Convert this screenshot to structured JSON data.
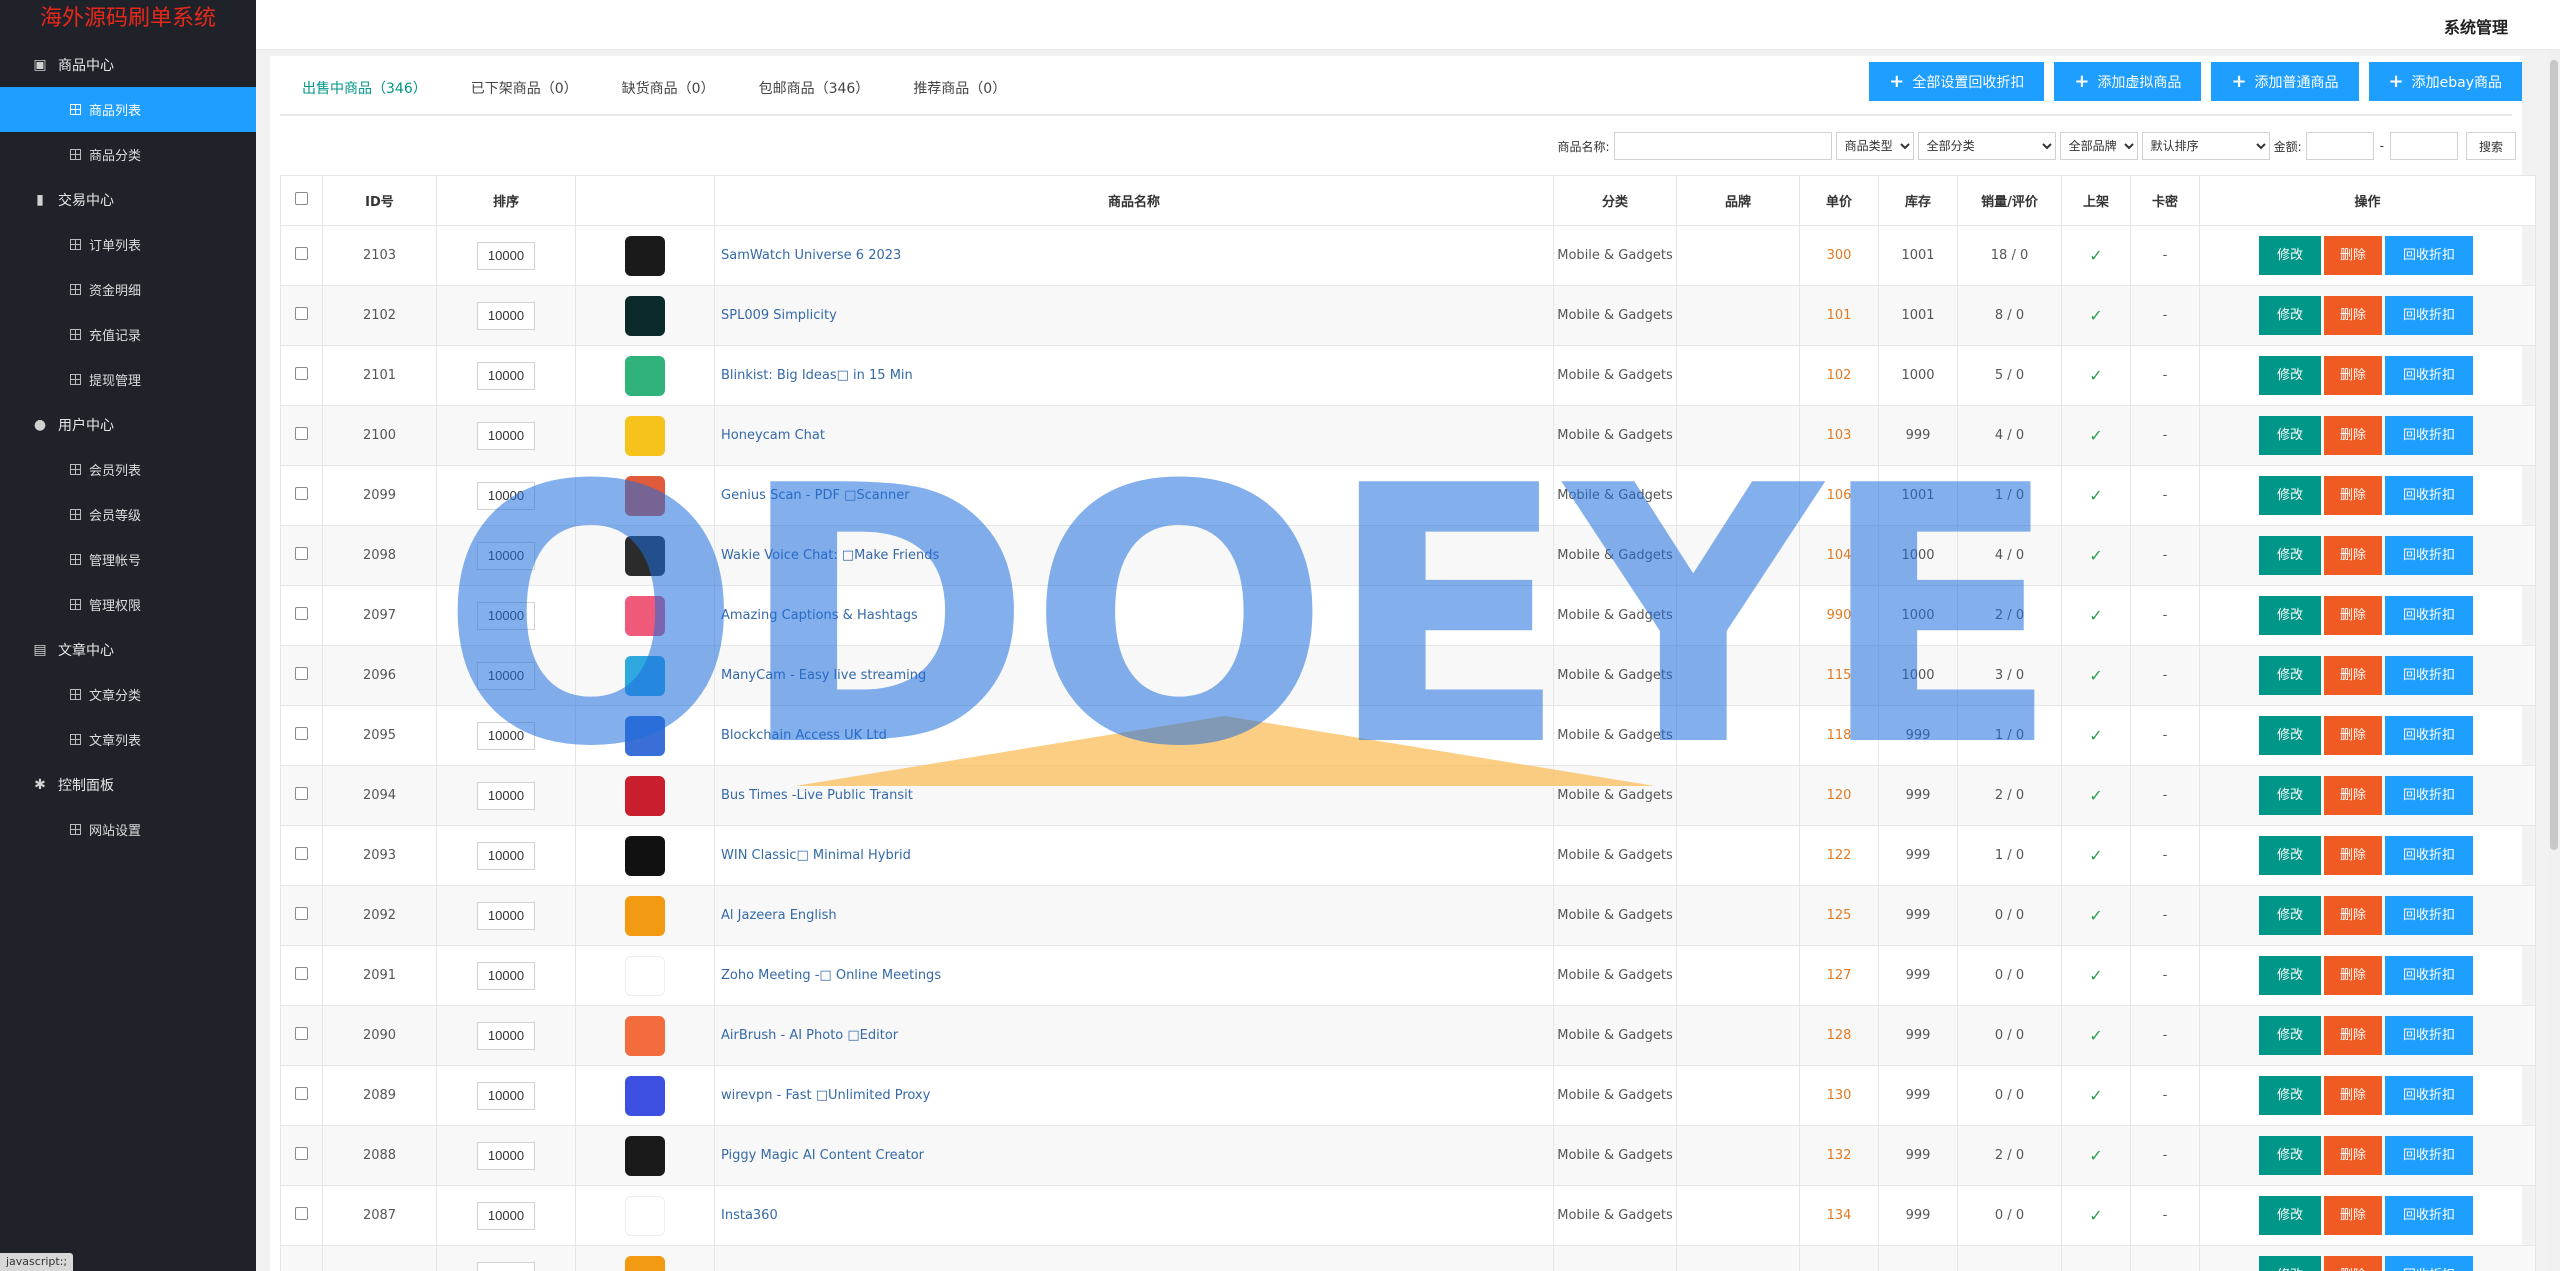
{
  "app_title": "海外源码刷单系统",
  "header": {
    "system_name": "系统管理"
  },
  "sidebar": {
    "sections": [
      {
        "label": "商品中心",
        "icon": "chart-box-icon",
        "items": [
          {
            "label": "商品列表",
            "active": true
          },
          {
            "label": "商品分类",
            "active": false
          }
        ]
      },
      {
        "label": "交易中心",
        "icon": "bar-chart-icon",
        "items": [
          {
            "label": "订单列表"
          },
          {
            "label": "资金明细"
          },
          {
            "label": "充值记录"
          },
          {
            "label": "提现管理"
          }
        ]
      },
      {
        "label": "用户中心",
        "icon": "user-icon",
        "items": [
          {
            "label": "会员列表"
          },
          {
            "label": "会员等级"
          },
          {
            "label": "管理帐号"
          },
          {
            "label": "管理权限"
          }
        ]
      },
      {
        "label": "文章中心",
        "icon": "document-icon",
        "items": [
          {
            "label": "文章分类"
          },
          {
            "label": "文章列表"
          }
        ]
      },
      {
        "label": "控制面板",
        "icon": "gear-icon",
        "items": [
          {
            "label": "网站设置"
          }
        ]
      }
    ]
  },
  "tabs": [
    {
      "label": "出售中商品（346）",
      "active": true
    },
    {
      "label": "已下架商品（0）"
    },
    {
      "label": "缺货商品（0）"
    },
    {
      "label": "包邮商品（346）"
    },
    {
      "label": "推荐商品（0）"
    }
  ],
  "actions": [
    "全部设置回收折扣",
    "添加虚拟商品",
    "添加普通商品",
    "添加ebay商品"
  ],
  "filters": {
    "name_label": "商品名称:",
    "name_value": "",
    "type_select": "商品类型",
    "category_select": "全部分类",
    "brand_select": "全部品牌",
    "sort_select": "默认排序",
    "amount_label": "金额:",
    "amount_sep": "-",
    "search_label": "搜索"
  },
  "table": {
    "headers": [
      "ID号",
      "排序",
      "商品名称",
      "分类",
      "品牌",
      "单价",
      "库存",
      "销量/评价",
      "上架",
      "卡密",
      "操作"
    ],
    "rows": [
      {
        "id": "2103",
        "sort": "10000",
        "name": "SamWatch Universe 6 2023",
        "category": "Mobile & Gadgets",
        "brand": "",
        "price": "300",
        "stock": "1001",
        "sales": "18 / 0",
        "card": "-",
        "thumb": "#1a1a1a"
      },
      {
        "id": "2102",
        "sort": "10000",
        "name": "SPL009 Simplicity",
        "category": "Mobile & Gadgets",
        "brand": "",
        "price": "101",
        "stock": "1001",
        "sales": "8 / 0",
        "card": "-",
        "thumb": "#0d2a2a"
      },
      {
        "id": "2101",
        "sort": "10000",
        "name": "Blinkist: Big Ideas\u0000 in 15 Min",
        "category": "Mobile & Gadgets",
        "brand": "",
        "price": "102",
        "stock": "1000",
        "sales": "5 / 0",
        "card": "-",
        "thumb": "#2fb37a"
      },
      {
        "id": "2100",
        "sort": "10000",
        "name": "Honeycam Chat",
        "category": "Mobile & Gadgets",
        "brand": "",
        "price": "103",
        "stock": "999",
        "sales": "4 / 0",
        "card": "-",
        "thumb": "#f6c21c"
      },
      {
        "id": "2099",
        "sort": "10000",
        "name": "Genius Scan - PDF \u0000Scanner",
        "category": "Mobile & Gadgets",
        "brand": "",
        "price": "106",
        "stock": "1001",
        "sales": "1 / 0",
        "card": "-",
        "thumb": "#e05a3c"
      },
      {
        "id": "2098",
        "sort": "10000",
        "name": "Wakie Voice Chat: \u0000Make Friends",
        "category": "Mobile & Gadgets",
        "brand": "",
        "price": "104",
        "stock": "1000",
        "sales": "4 / 0",
        "card": "-",
        "thumb": "#2b2b2b"
      },
      {
        "id": "2097",
        "sort": "10000",
        "name": "Amazing Captions & Hashtags",
        "category": "Mobile & Gadgets",
        "brand": "",
        "price": "990",
        "stock": "1000",
        "sales": "2 / 0",
        "card": "-",
        "thumb": "#f05a7a"
      },
      {
        "id": "2096",
        "sort": "10000",
        "name": "ManyCam - Easy live streaming",
        "category": "Mobile & Gadgets",
        "brand": "",
        "price": "115",
        "stock": "1000",
        "sales": "3 / 0",
        "card": "-",
        "thumb": "#2fa8e0"
      },
      {
        "id": "2095",
        "sort": "10000",
        "name": "Blockchain Access UK Ltd",
        "category": "Mobile & Gadgets",
        "brand": "",
        "price": "118",
        "stock": "999",
        "sales": "1 / 0",
        "card": "-",
        "thumb": "#3b6fd8"
      },
      {
        "id": "2094",
        "sort": "10000",
        "name": "Bus Times -Live Public Transit",
        "category": "Mobile & Gadgets",
        "brand": "",
        "price": "120",
        "stock": "999",
        "sales": "2 / 0",
        "card": "-",
        "thumb": "#c81e2e"
      },
      {
        "id": "2093",
        "sort": "10000",
        "name": "WIN Classic\u0000 Minimal Hybrid",
        "category": "Mobile & Gadgets",
        "brand": "",
        "price": "122",
        "stock": "999",
        "sales": "1 / 0",
        "card": "-",
        "thumb": "#111111"
      },
      {
        "id": "2092",
        "sort": "10000",
        "name": "Al Jazeera English",
        "category": "Mobile & Gadgets",
        "brand": "",
        "price": "125",
        "stock": "999",
        "sales": "0 / 0",
        "card": "-",
        "thumb": "#f29a11"
      },
      {
        "id": "2091",
        "sort": "10000",
        "name": "Zoho Meeting -\u0000 Online Meetings",
        "category": "Mobile & Gadgets",
        "brand": "",
        "price": "127",
        "stock": "999",
        "sales": "0 / 0",
        "card": "-",
        "thumb": "#ffffff"
      },
      {
        "id": "2090",
        "sort": "10000",
        "name": "AirBrush - AI Photo \u0000Editor",
        "category": "Mobile & Gadgets",
        "brand": "",
        "price": "128",
        "stock": "999",
        "sales": "0 / 0",
        "card": "-",
        "thumb": "#f36c3d"
      },
      {
        "id": "2089",
        "sort": "10000",
        "name": "wirevpn - Fast \u0000Unlimited Proxy",
        "category": "Mobile & Gadgets",
        "brand": "",
        "price": "130",
        "stock": "999",
        "sales": "0 / 0",
        "card": "-",
        "thumb": "#3d4fe0"
      },
      {
        "id": "2088",
        "sort": "10000",
        "name": "Piggy Magic AI Content Creator",
        "category": "Mobile & Gadgets",
        "brand": "",
        "price": "132",
        "stock": "999",
        "sales": "2 / 0",
        "card": "-",
        "thumb": "#1a1a1a"
      },
      {
        "id": "2087",
        "sort": "10000",
        "name": "Insta360",
        "category": "Mobile & Gadgets",
        "brand": "",
        "price": "134",
        "stock": "999",
        "sales": "0 / 0",
        "card": "-",
        "thumb": "#ffffff"
      },
      {
        "id": "",
        "sort": "",
        "name": "",
        "category": "",
        "brand": "",
        "price": "",
        "stock": "",
        "sales": "",
        "card": "",
        "thumb": "#f29a11"
      }
    ],
    "op_edit": "修改",
    "op_delete": "删除",
    "op_recycle": "回收折扣"
  },
  "watermark": "ODOEYE",
  "status_bar": "javascript:;",
  "colors": {
    "sidebar_bg": "#20222a",
    "accent_blue": "#1e9fff",
    "teal": "#009688",
    "orange": "#f05a23",
    "brand_red": "#e6281a"
  }
}
